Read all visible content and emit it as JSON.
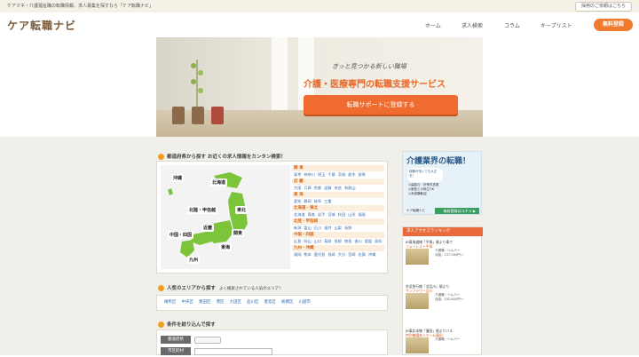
{
  "topbar": {
    "tagline": "ケアマネ・介護福祉職の転職情報、求人募集を探すなら「ケア転職ナビ」",
    "corp_link": "採用のご依頼はこちら"
  },
  "header": {
    "logo": "ケア転職ナビ",
    "nav": [
      "ホーム",
      "求人検索",
      "コラム",
      "キープリスト"
    ],
    "register": "無料登録"
  },
  "hero": {
    "catch": "きっと見つかる新しい職場",
    "heading": "介護・医療専門の転職支援サービス",
    "cta": "転職サポートに登録する"
  },
  "map_section": {
    "title": "都道府県から探す お近くの求人情報をカンタン検索！",
    "regions": [
      "沖縄",
      "北海道",
      "北陸・甲信越",
      "東北",
      "関東",
      "中国・四国",
      "近畿",
      "東海",
      "九州"
    ],
    "pref_groups": [
      {
        "name": "関 東",
        "prefs": [
          "東京",
          "神奈川",
          "埼玉",
          "千葉",
          "茨城",
          "栃木",
          "群馬"
        ]
      },
      {
        "name": "近 畿",
        "prefs": [
          "大阪",
          "兵庫",
          "京都",
          "滋賀",
          "奈良",
          "和歌山"
        ]
      },
      {
        "name": "東 海",
        "prefs": [
          "愛知",
          "静岡",
          "岐阜",
          "三重"
        ]
      },
      {
        "name": "北海道・東北",
        "prefs": [
          "北海道",
          "青森",
          "岩手",
          "宮城",
          "秋田",
          "山形",
          "福島"
        ]
      },
      {
        "name": "北陸・甲信越",
        "prefs": [
          "新潟",
          "富山",
          "石川",
          "福井",
          "山梨",
          "長野"
        ]
      },
      {
        "name": "中国・四国",
        "prefs": [
          "広島",
          "岡山",
          "山口",
          "鳥取",
          "島根",
          "徳島",
          "香川",
          "愛媛",
          "高知"
        ]
      },
      {
        "name": "九州・沖縄",
        "prefs": [
          "福岡",
          "熊本",
          "鹿児島",
          "長崎",
          "大分",
          "宮崎",
          "佐賀",
          "沖縄"
        ]
      }
    ]
  },
  "area_section": {
    "title": "人気のエリアから探す",
    "subtitle": "よく検索されている人気のエリア！",
    "areas": [
      "練馬区",
      "中央区",
      "墨田区",
      "港区",
      "大田区",
      "品川区",
      "豊島区",
      "板橋区",
      "川越市"
    ]
  },
  "condition_section": {
    "title": "条件を絞り込んで探す",
    "labels": [
      "都道府県",
      "市区町村"
    ]
  },
  "ad": {
    "title": "介護業界の転職！",
    "bubble": "経験が浅くても大丈夫！",
    "points": [
      "◎高給与・好条件多数",
      "◎家庭との両立OK",
      "◎未経験歓迎"
    ],
    "brand": "ケア転職ナビ",
    "button": "無料登録はコチラ ▶"
  },
  "ranking": {
    "title": "求人アクセスランキング",
    "items": [
      {
        "line1": "JR東海道線「平塚」駅より車で",
        "line2": "フォーレスト平塚",
        "job": "介護職・ヘルパー",
        "salary": "月給：237,000円～"
      },
      {
        "line1": "京浜急行線「北品川」駅より",
        "line2": "サンフラワー品川",
        "job": "介護職・ヘルパー",
        "salary": "月給：232,600円～"
      },
      {
        "line1": "JR東北本線「蓮田」駅よりバス",
        "line2": "特別養護老人ホーム蓮田",
        "job": "介護職・ヘルパー",
        "salary": ""
      }
    ]
  },
  "colors": {
    "accent": "#f07a2e",
    "brand": "#7a5a3a",
    "link": "#3a6fb0"
  }
}
